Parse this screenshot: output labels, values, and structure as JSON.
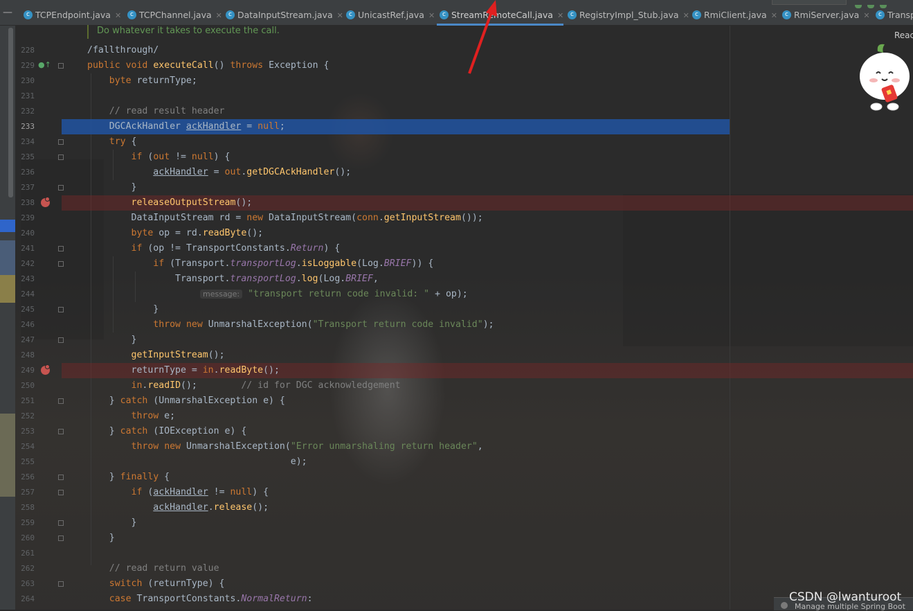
{
  "tabs": [
    {
      "label": "TCPEndpoint.java"
    },
    {
      "label": "TCPChannel.java"
    },
    {
      "label": "DataInputStream.java"
    },
    {
      "label": "UnicastRef.java"
    },
    {
      "label": "StreamRemoteCall.java"
    },
    {
      "label": "RegistryImpl_Stub.java"
    },
    {
      "label": "RmiClient.java"
    },
    {
      "label": "RmiServer.java"
    },
    {
      "label": "Transp"
    }
  ],
  "doc_comment": "Do whatever it takes to execute the call.",
  "reader_mode_label": "Reac",
  "watermark": "CSDN @lwanturoot",
  "notification": "Manage multiple Spring Boot",
  "current_line": "233",
  "colors": {
    "highlight": "#2154a1",
    "breakpoint": "#c75450",
    "keyword": "#cc7832",
    "string": "#6a8759",
    "comment": "#808080"
  },
  "param_hint": "message:",
  "lines": [
    {
      "num": "228",
      "code": "/fallthrough/"
    },
    {
      "num": "229",
      "code": "public void executeCall() throws Exception {"
    },
    {
      "num": "230",
      "code": "    byte returnType;"
    },
    {
      "num": "231",
      "code": ""
    },
    {
      "num": "232",
      "code": "    // read result header"
    },
    {
      "num": "233",
      "code": "    DGCAckHandler ackHandler = null;"
    },
    {
      "num": "234",
      "code": "    try {"
    },
    {
      "num": "235",
      "code": "        if (out != null) {"
    },
    {
      "num": "236",
      "code": "            ackHandler = out.getDGCAckHandler();"
    },
    {
      "num": "237",
      "code": "        }"
    },
    {
      "num": "238",
      "code": "        releaseOutputStream();"
    },
    {
      "num": "239",
      "code": "        DataInputStream rd = new DataInputStream(conn.getInputStream());"
    },
    {
      "num": "240",
      "code": "        byte op = rd.readByte();"
    },
    {
      "num": "241",
      "code": "        if (op != TransportConstants.Return) {"
    },
    {
      "num": "242",
      "code": "            if (Transport.transportLog.isLoggable(Log.BRIEF)) {"
    },
    {
      "num": "243",
      "code": "                Transport.transportLog.log(Log.BRIEF,"
    },
    {
      "num": "244",
      "code": "\"transport return code invalid: \" + op);"
    },
    {
      "num": "245",
      "code": "            }"
    },
    {
      "num": "246",
      "code": "            throw new UnmarshalException(\"Transport return code invalid\");"
    },
    {
      "num": "247",
      "code": "        }"
    },
    {
      "num": "248",
      "code": "        getInputStream();"
    },
    {
      "num": "249",
      "code": "        returnType = in.readByte();"
    },
    {
      "num": "250",
      "code": "        in.readID();        // id for DGC acknowledgement"
    },
    {
      "num": "251",
      "code": "    } catch (UnmarshalException e) {"
    },
    {
      "num": "252",
      "code": "        throw e;"
    },
    {
      "num": "253",
      "code": "    } catch (IOException e) {"
    },
    {
      "num": "254",
      "code": "        throw new UnmarshalException(\"Error unmarshaling return header\","
    },
    {
      "num": "255",
      "code": "                                     e);"
    },
    {
      "num": "256",
      "code": "    } finally {"
    },
    {
      "num": "257",
      "code": "        if (ackHandler != null) {"
    },
    {
      "num": "258",
      "code": "            ackHandler.release();"
    },
    {
      "num": "259",
      "code": "        }"
    },
    {
      "num": "260",
      "code": "    }"
    },
    {
      "num": "261",
      "code": ""
    },
    {
      "num": "262",
      "code": "    // read return value"
    },
    {
      "num": "263",
      "code": "    switch (returnType) {"
    },
    {
      "num": "264",
      "code": "    case TransportConstants.NormalReturn:"
    }
  ]
}
